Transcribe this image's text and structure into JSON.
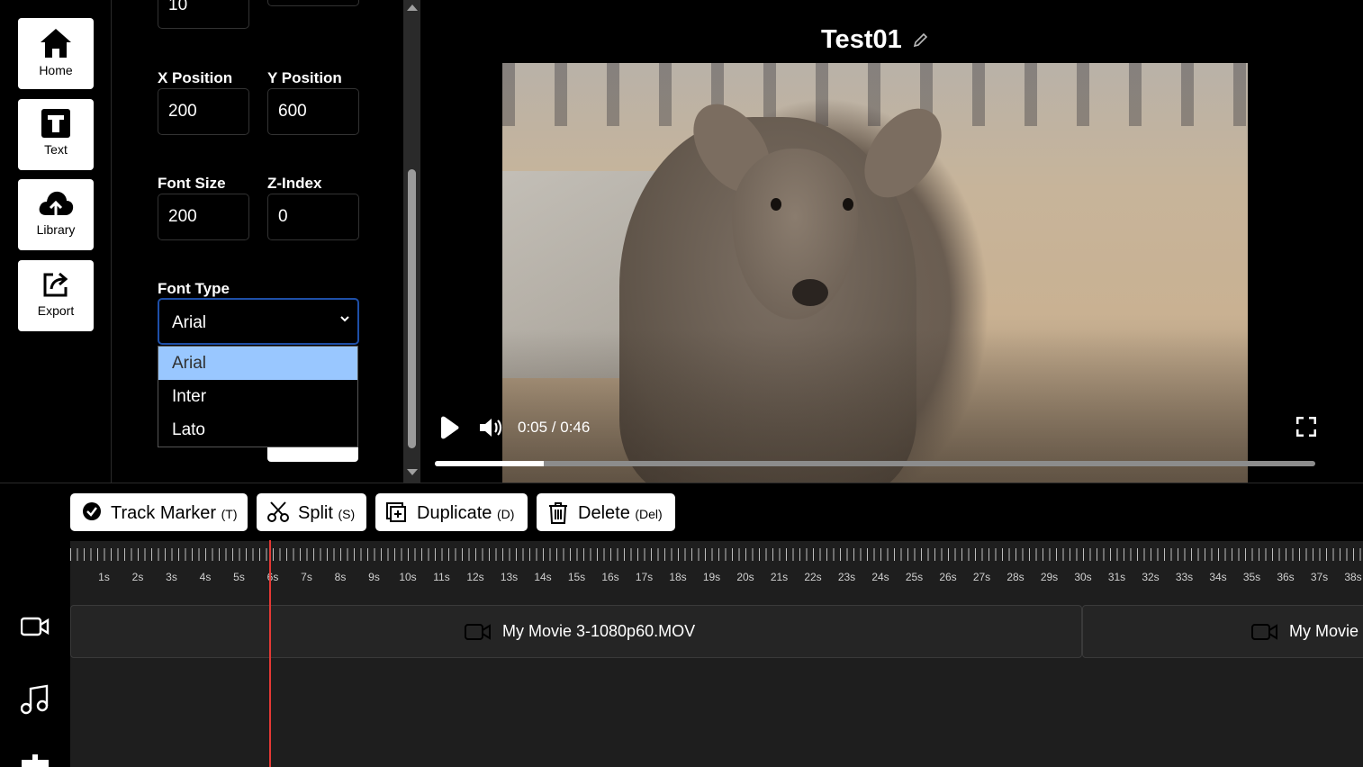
{
  "nav": {
    "home_label": "Home",
    "text_label": "Text",
    "library_label": "Library",
    "export_label": "Export"
  },
  "props": {
    "top_value_1": "10",
    "top_value_2": "",
    "x_label": "X Position",
    "x_value": "200",
    "y_label": "Y Position",
    "y_value": "600",
    "font_size_label": "Font Size",
    "font_size_value": "200",
    "z_label": "Z-Index",
    "z_value": "0",
    "font_type_label": "Font Type",
    "font_type_value": "Arial",
    "font_options": [
      "Arial",
      "Inter",
      "Lato"
    ]
  },
  "preview": {
    "title": "Test01",
    "time": "0:05 / 0:46",
    "progress_fraction": 0.124
  },
  "toolbar": {
    "track_marker_label": "Track Marker",
    "track_marker_shortcut": "(T)",
    "split_label": "Split",
    "split_shortcut": "(S)",
    "duplicate_label": "Duplicate",
    "duplicate_shortcut": "(D)",
    "delete_label": "Delete",
    "delete_shortcut": "(Del)"
  },
  "timeline": {
    "tick_labels": [
      "1s",
      "2s",
      "3s",
      "4s",
      "5s",
      "6s",
      "7s",
      "8s",
      "9s",
      "10s",
      "11s",
      "12s",
      "13s",
      "14s",
      "15s",
      "16s",
      "17s",
      "18s",
      "19s",
      "20s",
      "21s",
      "22s",
      "23s",
      "24s",
      "25s",
      "26s",
      "27s",
      "28s",
      "29s",
      "30s",
      "31s",
      "32s",
      "33s",
      "34s",
      "35s",
      "36s",
      "37s",
      "38s"
    ],
    "clip1_name": "My Movie 3-1080p60.MOV",
    "clip2_name": "My Movie",
    "playhead_seconds": 5.9
  },
  "colors": {
    "accent_selected": "#99c7ff",
    "playhead": "#e53935",
    "select_border": "#1e4fa8"
  }
}
